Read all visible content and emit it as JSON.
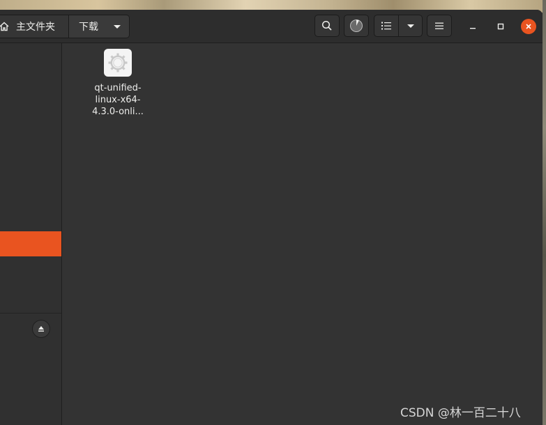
{
  "path_bar": {
    "home_label": "主文件夹",
    "current_label": "下载"
  },
  "files": [
    {
      "name_lines": [
        "qt-unified-",
        "linux-x64-",
        "4.3.0-onli..."
      ],
      "icon": "settings-gear-icon"
    }
  ],
  "icons": {
    "home": "home-icon",
    "search": "search-icon",
    "progress": "operations-progress-icon",
    "list_view": "list-view-icon",
    "view_options": "chevron-down-icon",
    "menu": "hamburger-menu-icon",
    "minimize": "minimize-icon",
    "maximize": "maximize-icon",
    "close": "close-icon",
    "eject": "eject-icon"
  },
  "colors": {
    "accent": "#e95420",
    "window_bg": "#333333",
    "sidebar_bg": "#303030",
    "text": "#eeeeec"
  },
  "watermark": "CSDN @林一百二十八"
}
